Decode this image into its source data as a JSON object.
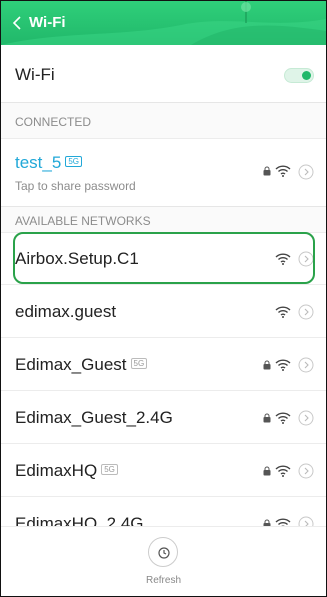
{
  "header": {
    "back_icon": "chevron-left-icon",
    "title": "Wi-Fi"
  },
  "wifi_toggle": {
    "label": "Wi-Fi",
    "enabled": true
  },
  "sections": {
    "connected": "CONNECTED",
    "available": "AVAILABLE NETWORKS"
  },
  "connected_network": {
    "name": "test_5",
    "band_badge": "5G",
    "subtitle": "Tap to share password",
    "locked": true
  },
  "networks": [
    {
      "name": "Airbox.Setup.C1",
      "band_badge": "",
      "locked": false
    },
    {
      "name": "edimax.guest",
      "band_badge": "",
      "locked": false
    },
    {
      "name": "Edimax_Guest",
      "band_badge": "5G",
      "locked": true
    },
    {
      "name": "Edimax_Guest_2.4G",
      "band_badge": "",
      "locked": true
    },
    {
      "name": "EdimaxHQ",
      "band_badge": "5G",
      "locked": true
    },
    {
      "name": "EdimaxHQ_2.4G",
      "band_badge": "",
      "locked": true
    }
  ],
  "highlighted_network": "Airbox.Setup.C1",
  "bottom": {
    "refresh_label": "Refresh"
  },
  "colors": {
    "header": "#21b86a",
    "connected_text": "#21a8d8",
    "highlight": "#2aa24a"
  }
}
